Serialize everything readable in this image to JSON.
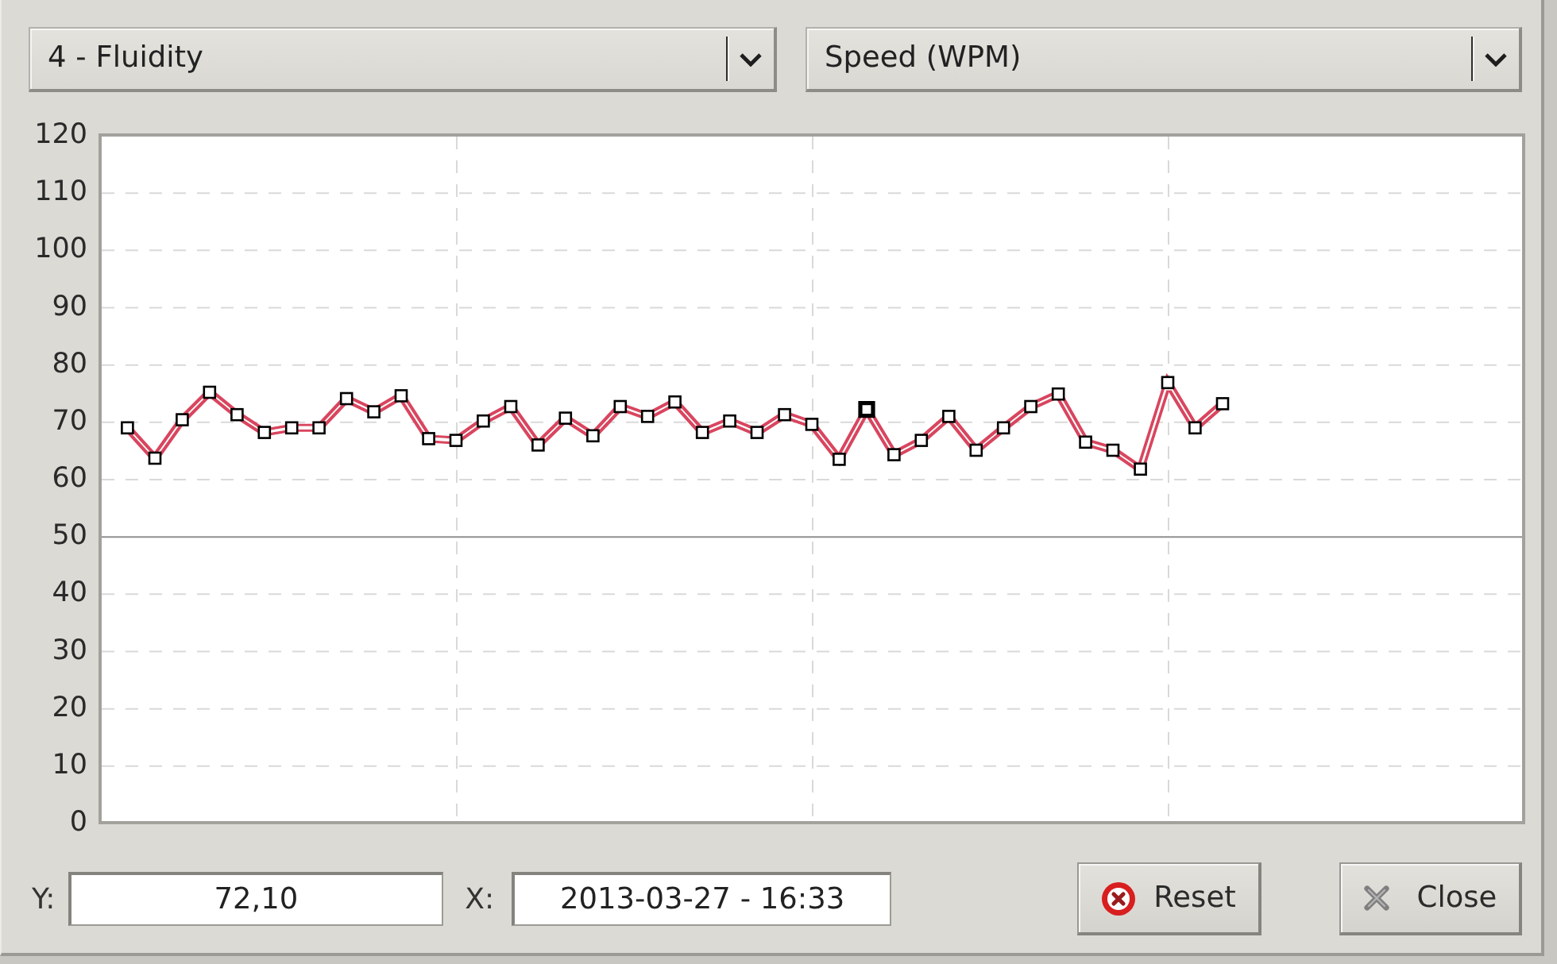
{
  "selectors": [
    {
      "value": "4 - Fluidity"
    },
    {
      "value": "Speed (WPM)"
    }
  ],
  "chart": {
    "chart_data": {
      "type": "line",
      "categories": [
        null,
        null,
        null,
        null,
        null,
        null,
        null,
        null,
        null,
        null,
        null,
        null,
        null,
        null,
        null,
        null,
        null,
        null,
        null,
        null,
        null,
        null,
        null,
        null,
        null,
        null,
        null,
        null,
        null,
        null,
        null,
        null,
        null,
        null,
        null,
        null,
        null,
        null,
        null,
        null,
        null
      ],
      "series": [
        {
          "color": "#d9445f",
          "marker": "square",
          "values": [
            68.9,
            63.6,
            70.3,
            75.1,
            71.2,
            68.1,
            68.9,
            68.9,
            74.0,
            71.7,
            74.5,
            67.0,
            66.7,
            70.1,
            72.6,
            65.9,
            70.6,
            67.5,
            72.6,
            70.9,
            73.4,
            68.1,
            70.1,
            68.1,
            71.2,
            69.5,
            63.4,
            72.1,
            64.2,
            66.7,
            70.9,
            65.0,
            68.9,
            72.6,
            74.8,
            66.4,
            65.0,
            61.7,
            76.8,
            68.9,
            73.1
          ]
        }
      ],
      "ylim": [
        0,
        120
      ],
      "yticks": [
        0,
        10,
        20,
        30,
        40,
        50,
        60,
        70,
        80,
        90,
        100,
        110,
        120
      ],
      "grid": true,
      "ref_lines": [
        {
          "value": 50,
          "axis": "y"
        }
      ]
    },
    "points": [
      {
        "selected": false
      },
      {
        "selected": false
      },
      {
        "selected": false
      },
      {
        "selected": false
      },
      {
        "selected": false
      },
      {
        "selected": false
      },
      {
        "selected": false
      },
      {
        "selected": false
      },
      {
        "selected": false
      },
      {
        "selected": false
      },
      {
        "selected": false
      },
      {
        "selected": false
      },
      {
        "selected": false
      },
      {
        "selected": false
      },
      {
        "selected": false
      },
      {
        "selected": false
      },
      {
        "selected": false
      },
      {
        "selected": false
      },
      {
        "selected": false
      },
      {
        "selected": false
      },
      {
        "selected": false
      },
      {
        "selected": false
      },
      {
        "selected": false
      },
      {
        "selected": false
      },
      {
        "selected": false
      },
      {
        "selected": false
      },
      {
        "selected": false
      },
      {
        "selected": true
      },
      {
        "selected": false
      },
      {
        "selected": false
      },
      {
        "selected": false
      },
      {
        "selected": false
      },
      {
        "selected": false
      },
      {
        "selected": false
      },
      {
        "selected": false
      },
      {
        "selected": false
      },
      {
        "selected": false
      },
      {
        "selected": false
      },
      {
        "selected": false
      },
      {
        "selected": false
      },
      {
        "selected": false
      }
    ]
  },
  "readouts": [
    {
      "label": "Y:",
      "value": "72,10"
    },
    {
      "label": "X:",
      "value": "2013-03-27 - 16:33"
    }
  ],
  "buttons": [
    {
      "kind": "reset",
      "label": "Reset"
    },
    {
      "kind": "close",
      "label": "Close"
    }
  ]
}
